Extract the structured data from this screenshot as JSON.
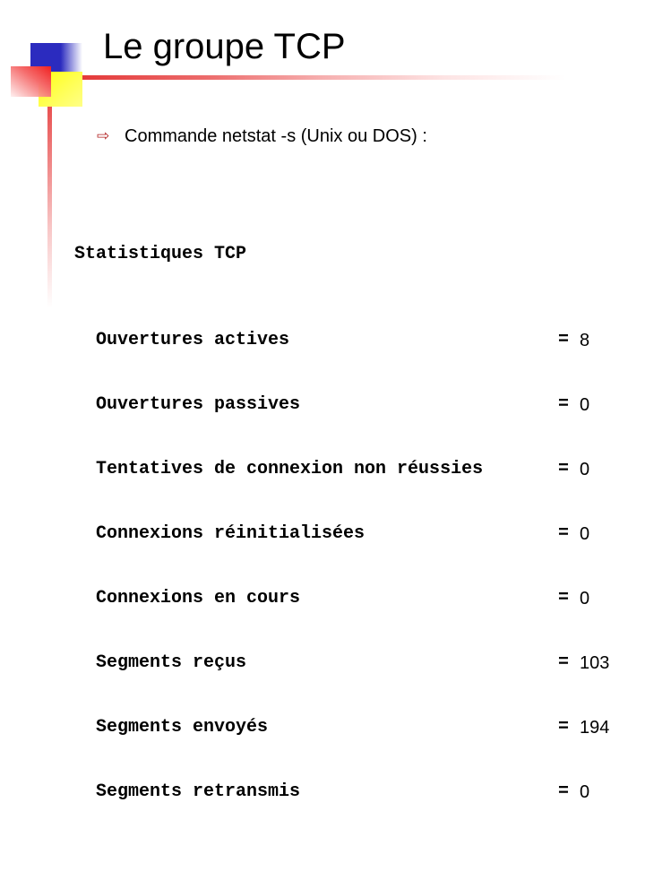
{
  "slide": {
    "title": "Le groupe TCP",
    "bullet_icon": "hollow-right-arrow",
    "bullet_text": "Commande netstat -s (Unix ou DOS) :",
    "colors": {
      "accent_red": "#e43a3a",
      "accent_blue": "#2b2bbf",
      "accent_yellow": "#ffff10",
      "bullet_arrow": "#b22222"
    }
  },
  "stats": {
    "heading": "Statistiques TCP",
    "rows": [
      {
        "label": "Ouvertures actives",
        "eq": "=",
        "value": "8"
      },
      {
        "label": "Ouvertures passives",
        "eq": "=",
        "value": "0"
      },
      {
        "label": "Tentatives de connexion non réussies",
        "eq": "=",
        "value": "0"
      },
      {
        "label": "Connexions réinitialisées",
        "eq": "=",
        "value": "0"
      },
      {
        "label": "Connexions en cours",
        "eq": "=",
        "value": "0"
      },
      {
        "label": "Segments reçus",
        "eq": "=",
        "value": "103"
      },
      {
        "label": "Segments envoyés",
        "eq": "=",
        "value": "194"
      },
      {
        "label": "Segments retransmis",
        "eq": "=",
        "value": "0"
      }
    ]
  }
}
